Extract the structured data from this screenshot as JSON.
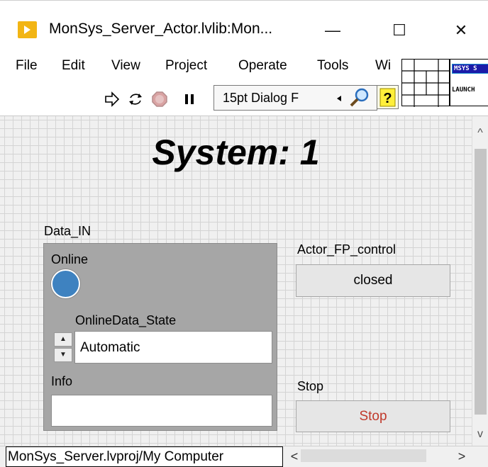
{
  "window": {
    "title": "MonSys_Server_Actor.lvlib:Mon...",
    "min_glyph": "—",
    "max_glyph": "☐",
    "close_glyph": "✕"
  },
  "menu": [
    "File",
    "Edit",
    "View",
    "Project",
    "Operate",
    "Tools",
    "Wi"
  ],
  "toolbar": {
    "font_select": "15pt Dialog F",
    "help_glyph": "?",
    "icons": [
      "run-arrow-icon",
      "run-continuously-icon",
      "abort-icon",
      "pause-icon",
      "search-icon",
      "help-icon"
    ]
  },
  "vi_icon": {
    "top_text": "MSYS S",
    "bottom_text": "LAUNCH"
  },
  "panel": {
    "title": "System: 1",
    "data_in_label": "Data_IN",
    "online_label": "Online",
    "online_led_color": "#3e82c0",
    "online_data_state_label": "OnlineData_State",
    "online_data_state_value": "Automatic",
    "info_label": "Info",
    "info_value": "",
    "actor_fp_label": "Actor_FP_control",
    "actor_fp_value": "closed",
    "stop_label": "Stop",
    "stop_button_text": "Stop",
    "stop_text_color": "#c0392b"
  },
  "status": {
    "context": "MonSys_Server.lvproj/My Computer"
  },
  "scroll": {
    "up": "^",
    "down": "v",
    "left": "<",
    "right": ">"
  }
}
